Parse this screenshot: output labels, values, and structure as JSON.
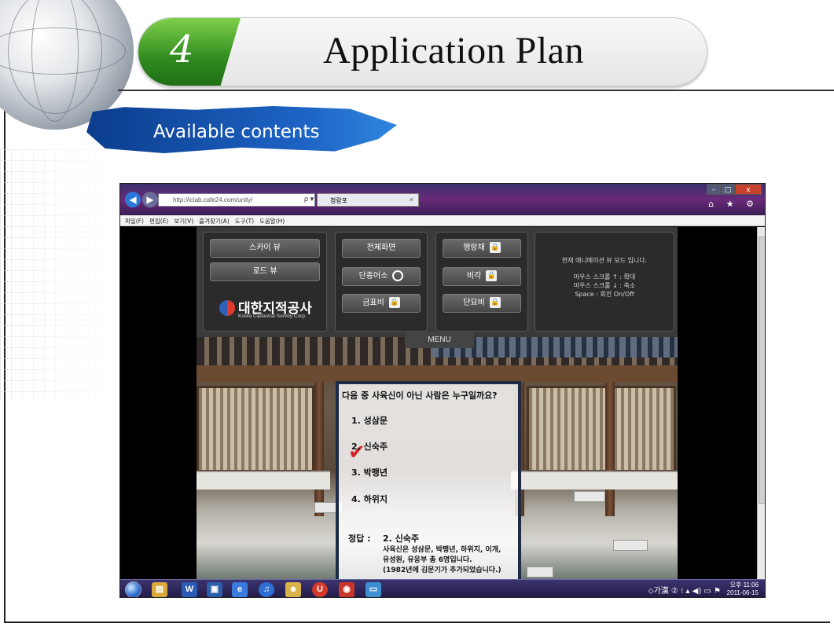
{
  "slide": {
    "section_number": "4",
    "title": "Application Plan",
    "subtitle": "Available contents"
  },
  "browser": {
    "url": "http://iclab.cafe24.com/unity/",
    "url_controls": "ρ ▾ ⊠ ₵ ✕",
    "tab_title": "청랑포",
    "tab_close": "×",
    "window_controls": [
      "–",
      "□",
      "x"
    ],
    "right_icons": "⌂ ★ ⚙",
    "menu_items": [
      "파일(F)",
      "편집(E)",
      "보기(V)",
      "즐겨찾기(A)",
      "도구(T)",
      "도움말(H)"
    ]
  },
  "unity_menu": {
    "view_buttons": [
      "스카이 뷰",
      "로드 뷰"
    ],
    "mid_buttons": [
      "전체화면",
      "단종어소",
      "금표비"
    ],
    "right_buttons": [
      "행랑채",
      "비각",
      "단묘비"
    ],
    "logo_korean": "대한지적공사",
    "logo_english": "Korea Cadastral Survey Corp.",
    "info": {
      "line1": "현재 애니메이션 뷰 모드 입니다.",
      "line2": "마우스 스크롤 ↑ : 확대",
      "line3": "마우스 스크롤 ↓ : 축소",
      "line4": "Space : 회전 On/Off"
    },
    "menu_tab": "MENU"
  },
  "quiz": {
    "question": "다음 중 사육신이 아닌 사람은 누구일까요?",
    "options": [
      "1. 성삼문",
      "2. 신숙주",
      "3. 박팽년",
      "4. 하위지"
    ],
    "selected_index": 1,
    "answer_label": "정답 :",
    "answer_value": "2. 신숙주",
    "explanation": [
      "사육신은 성삼문, 박팽년, 하위지, 이개,",
      "유성원, 유응부 총 6명입니다.",
      "(1982년에 김문기가 추가되었습니다.)"
    ]
  },
  "taskbar": {
    "icons": [
      "folder-icon",
      "word-icon",
      "media-icon",
      "ie-icon",
      "itunes-icon",
      "messenger-icon",
      "u-icon",
      "app-icon",
      "monitor-icon"
    ],
    "tray_symbols": "⬦가漢 ② ⁝ ▴ ◀) ▭ ⚑",
    "time": "오후 11:06",
    "date": "2011-06-15"
  },
  "colors": {
    "accent_green": "#2e8a1e",
    "banner_blue": "#1d63c4",
    "quiz_border": "#1d2b44",
    "check_red": "#d0242a"
  }
}
